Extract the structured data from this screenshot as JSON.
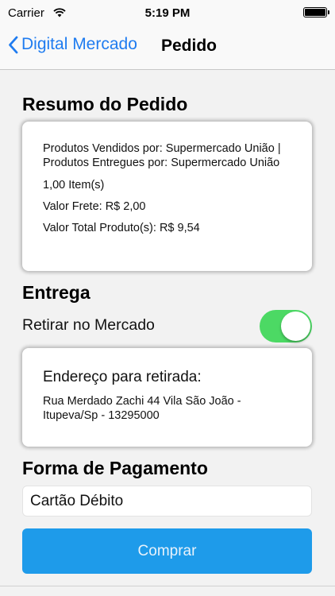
{
  "status_bar": {
    "carrier": "Carrier",
    "time": "5:19 PM"
  },
  "navbar": {
    "back_label": "Digital Mercado",
    "title": "Pedido"
  },
  "resumo": {
    "title": "Resumo do Pedido",
    "sellers": "Produtos Vendidos por: Supermercado União | Produtos Entregues por: Supermercado União",
    "items": "1,00 Item(s)",
    "frete": "Valor Frete: R$ 2,00",
    "total": "Valor Total Produto(s): R$ 9,54"
  },
  "entrega": {
    "title": "Entrega",
    "toggle_label": "Retirar no Mercado",
    "toggle_on": true,
    "address_title": "Endereço para retirada:",
    "address": "Rua Merdado Zachi 44  Vila São João - Itupeva/Sp - 13295000"
  },
  "pagamento": {
    "title": "Forma de Pagamento",
    "value": "Cartão Débito"
  },
  "buy_button": "Comprar",
  "colors": {
    "accent": "#1f7cf0",
    "button": "#1e9bea",
    "toggle_on": "#4cd964"
  }
}
